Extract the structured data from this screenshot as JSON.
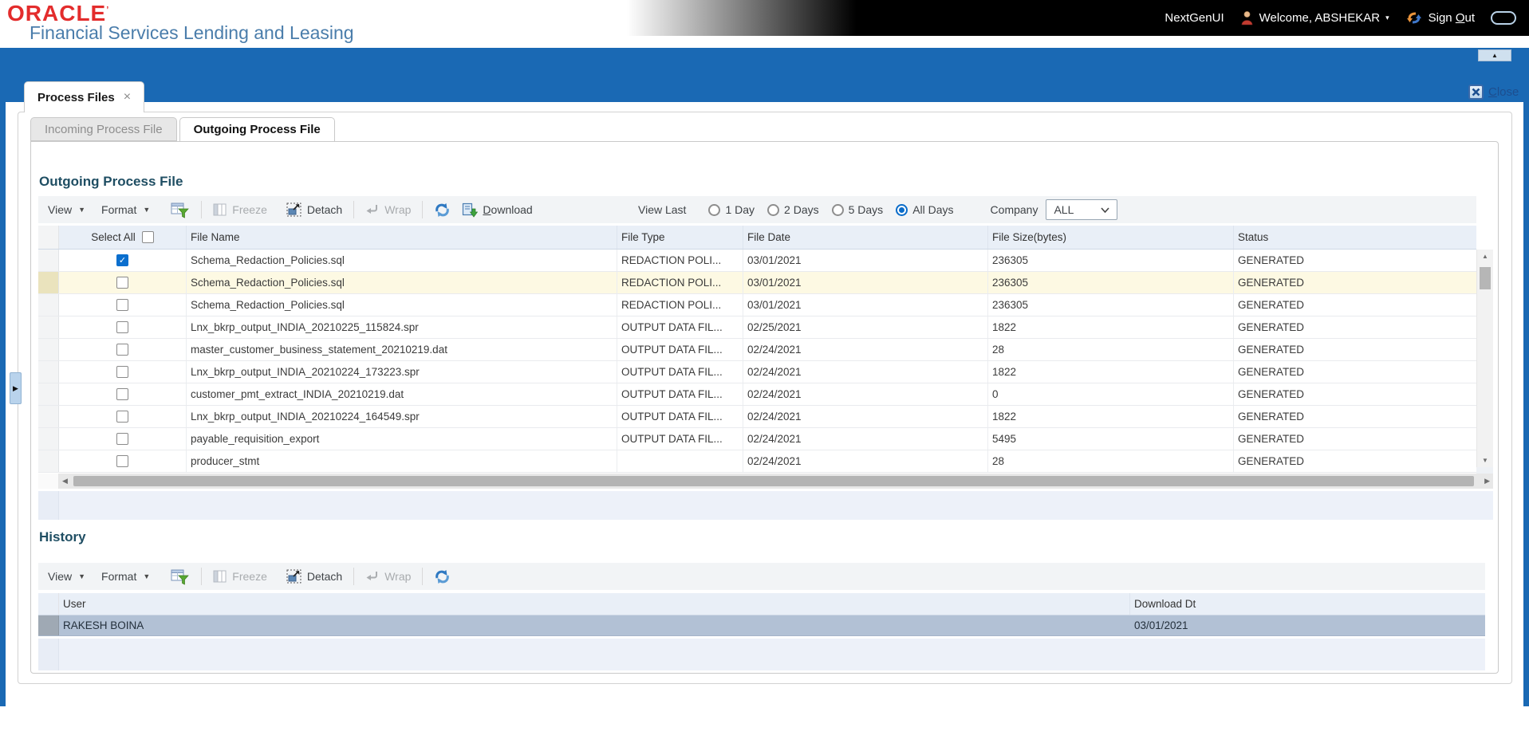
{
  "colors": {
    "frame_blue": "#1a69b4",
    "heading": "#1f4e63",
    "oracle_red": "#e32c2c",
    "product_blue": "#4a7dab",
    "radio_blue": "#0a6cc9",
    "checkbox_blue": "#0b6fce",
    "row_highlight": "#fdf9e3",
    "history_row_selected": "#b2c1d5",
    "table_header_bg": "#e9eff7"
  },
  "icons": {
    "collapse": "▲",
    "tab_close": "×",
    "caret_down": "▾",
    "scroll_up": "▲",
    "scroll_down": "▼",
    "scroll_left": "◀",
    "scroll_right": "▶",
    "check": "✓"
  },
  "header": {
    "brand": "ORACLE",
    "brand_mark": "’",
    "product": "Financial Services Lending and Leasing",
    "nextgen": "NextGenUI",
    "welcome": "Welcome, ABSHEKAR",
    "signout_pre": "Sign ",
    "signout_key": "O",
    "signout_rest": "ut"
  },
  "window": {
    "close_key": "C",
    "close_rest": "lose"
  },
  "page_tab": {
    "label": "Process Files"
  },
  "subtabs": [
    {
      "label": "Incoming Process File",
      "active": false
    },
    {
      "label": "Outgoing Process File",
      "active": true
    }
  ],
  "outgoing": {
    "title": "Outgoing Process File",
    "toolbar": {
      "view": "View",
      "format": "Format",
      "freeze": "Freeze",
      "detach": "Detach",
      "wrap": "Wrap",
      "download_key": "D",
      "download_rest": "ownload"
    },
    "filters": {
      "view_last_label": "View Last",
      "options": [
        {
          "label": "1 Day",
          "selected": false
        },
        {
          "label": "2 Days",
          "selected": false
        },
        {
          "label": "5 Days",
          "selected": false
        },
        {
          "label": "All Days",
          "selected": true
        }
      ],
      "company_label": "Company",
      "company_value": "ALL"
    },
    "table": {
      "select_all": "Select All",
      "columns": [
        "File Name",
        "File Type",
        "File Date",
        "File Size(bytes)",
        "Status"
      ],
      "rows": [
        {
          "checked": true,
          "highlight": false,
          "file_name": "Schema_Redaction_Policies.sql",
          "file_type": "REDACTION POLI...",
          "file_date": "03/01/2021",
          "file_size": "236305",
          "status": "GENERATED"
        },
        {
          "checked": false,
          "highlight": true,
          "file_name": "Schema_Redaction_Policies.sql",
          "file_type": "REDACTION POLI...",
          "file_date": "03/01/2021",
          "file_size": "236305",
          "status": "GENERATED"
        },
        {
          "checked": false,
          "highlight": false,
          "file_name": "Schema_Redaction_Policies.sql",
          "file_type": "REDACTION POLI...",
          "file_date": "03/01/2021",
          "file_size": "236305",
          "status": "GENERATED"
        },
        {
          "checked": false,
          "highlight": false,
          "file_name": "Lnx_bkrp_output_INDIA_20210225_115824.spr",
          "file_type": "OUTPUT DATA FIL...",
          "file_date": "02/25/2021",
          "file_size": "1822",
          "status": "GENERATED"
        },
        {
          "checked": false,
          "highlight": false,
          "file_name": "master_customer_business_statement_20210219.dat",
          "file_type": "OUTPUT DATA FIL...",
          "file_date": "02/24/2021",
          "file_size": "28",
          "status": "GENERATED"
        },
        {
          "checked": false,
          "highlight": false,
          "file_name": "Lnx_bkrp_output_INDIA_20210224_173223.spr",
          "file_type": "OUTPUT DATA FIL...",
          "file_date": "02/24/2021",
          "file_size": "1822",
          "status": "GENERATED"
        },
        {
          "checked": false,
          "highlight": false,
          "file_name": "customer_pmt_extract_INDIA_20210219.dat",
          "file_type": "OUTPUT DATA FIL...",
          "file_date": "02/24/2021",
          "file_size": "0",
          "status": "GENERATED"
        },
        {
          "checked": false,
          "highlight": false,
          "file_name": "Lnx_bkrp_output_INDIA_20210224_164549.spr",
          "file_type": "OUTPUT DATA FIL...",
          "file_date": "02/24/2021",
          "file_size": "1822",
          "status": "GENERATED"
        },
        {
          "checked": false,
          "highlight": false,
          "file_name": "payable_requisition_export",
          "file_type": "OUTPUT DATA FIL...",
          "file_date": "02/24/2021",
          "file_size": "5495",
          "status": "GENERATED"
        },
        {
          "checked": false,
          "highlight": false,
          "file_name": "producer_stmt",
          "file_type": "",
          "file_date": "02/24/2021",
          "file_size": "28",
          "status": "GENERATED"
        }
      ]
    }
  },
  "history": {
    "title": "History",
    "toolbar": {
      "view": "View",
      "format": "Format",
      "freeze": "Freeze",
      "detach": "Detach",
      "wrap": "Wrap"
    },
    "columns": [
      "User",
      "Download Dt"
    ],
    "rows": [
      {
        "user": "RAKESH BOINA",
        "download_dt": "03/01/2021"
      }
    ]
  }
}
